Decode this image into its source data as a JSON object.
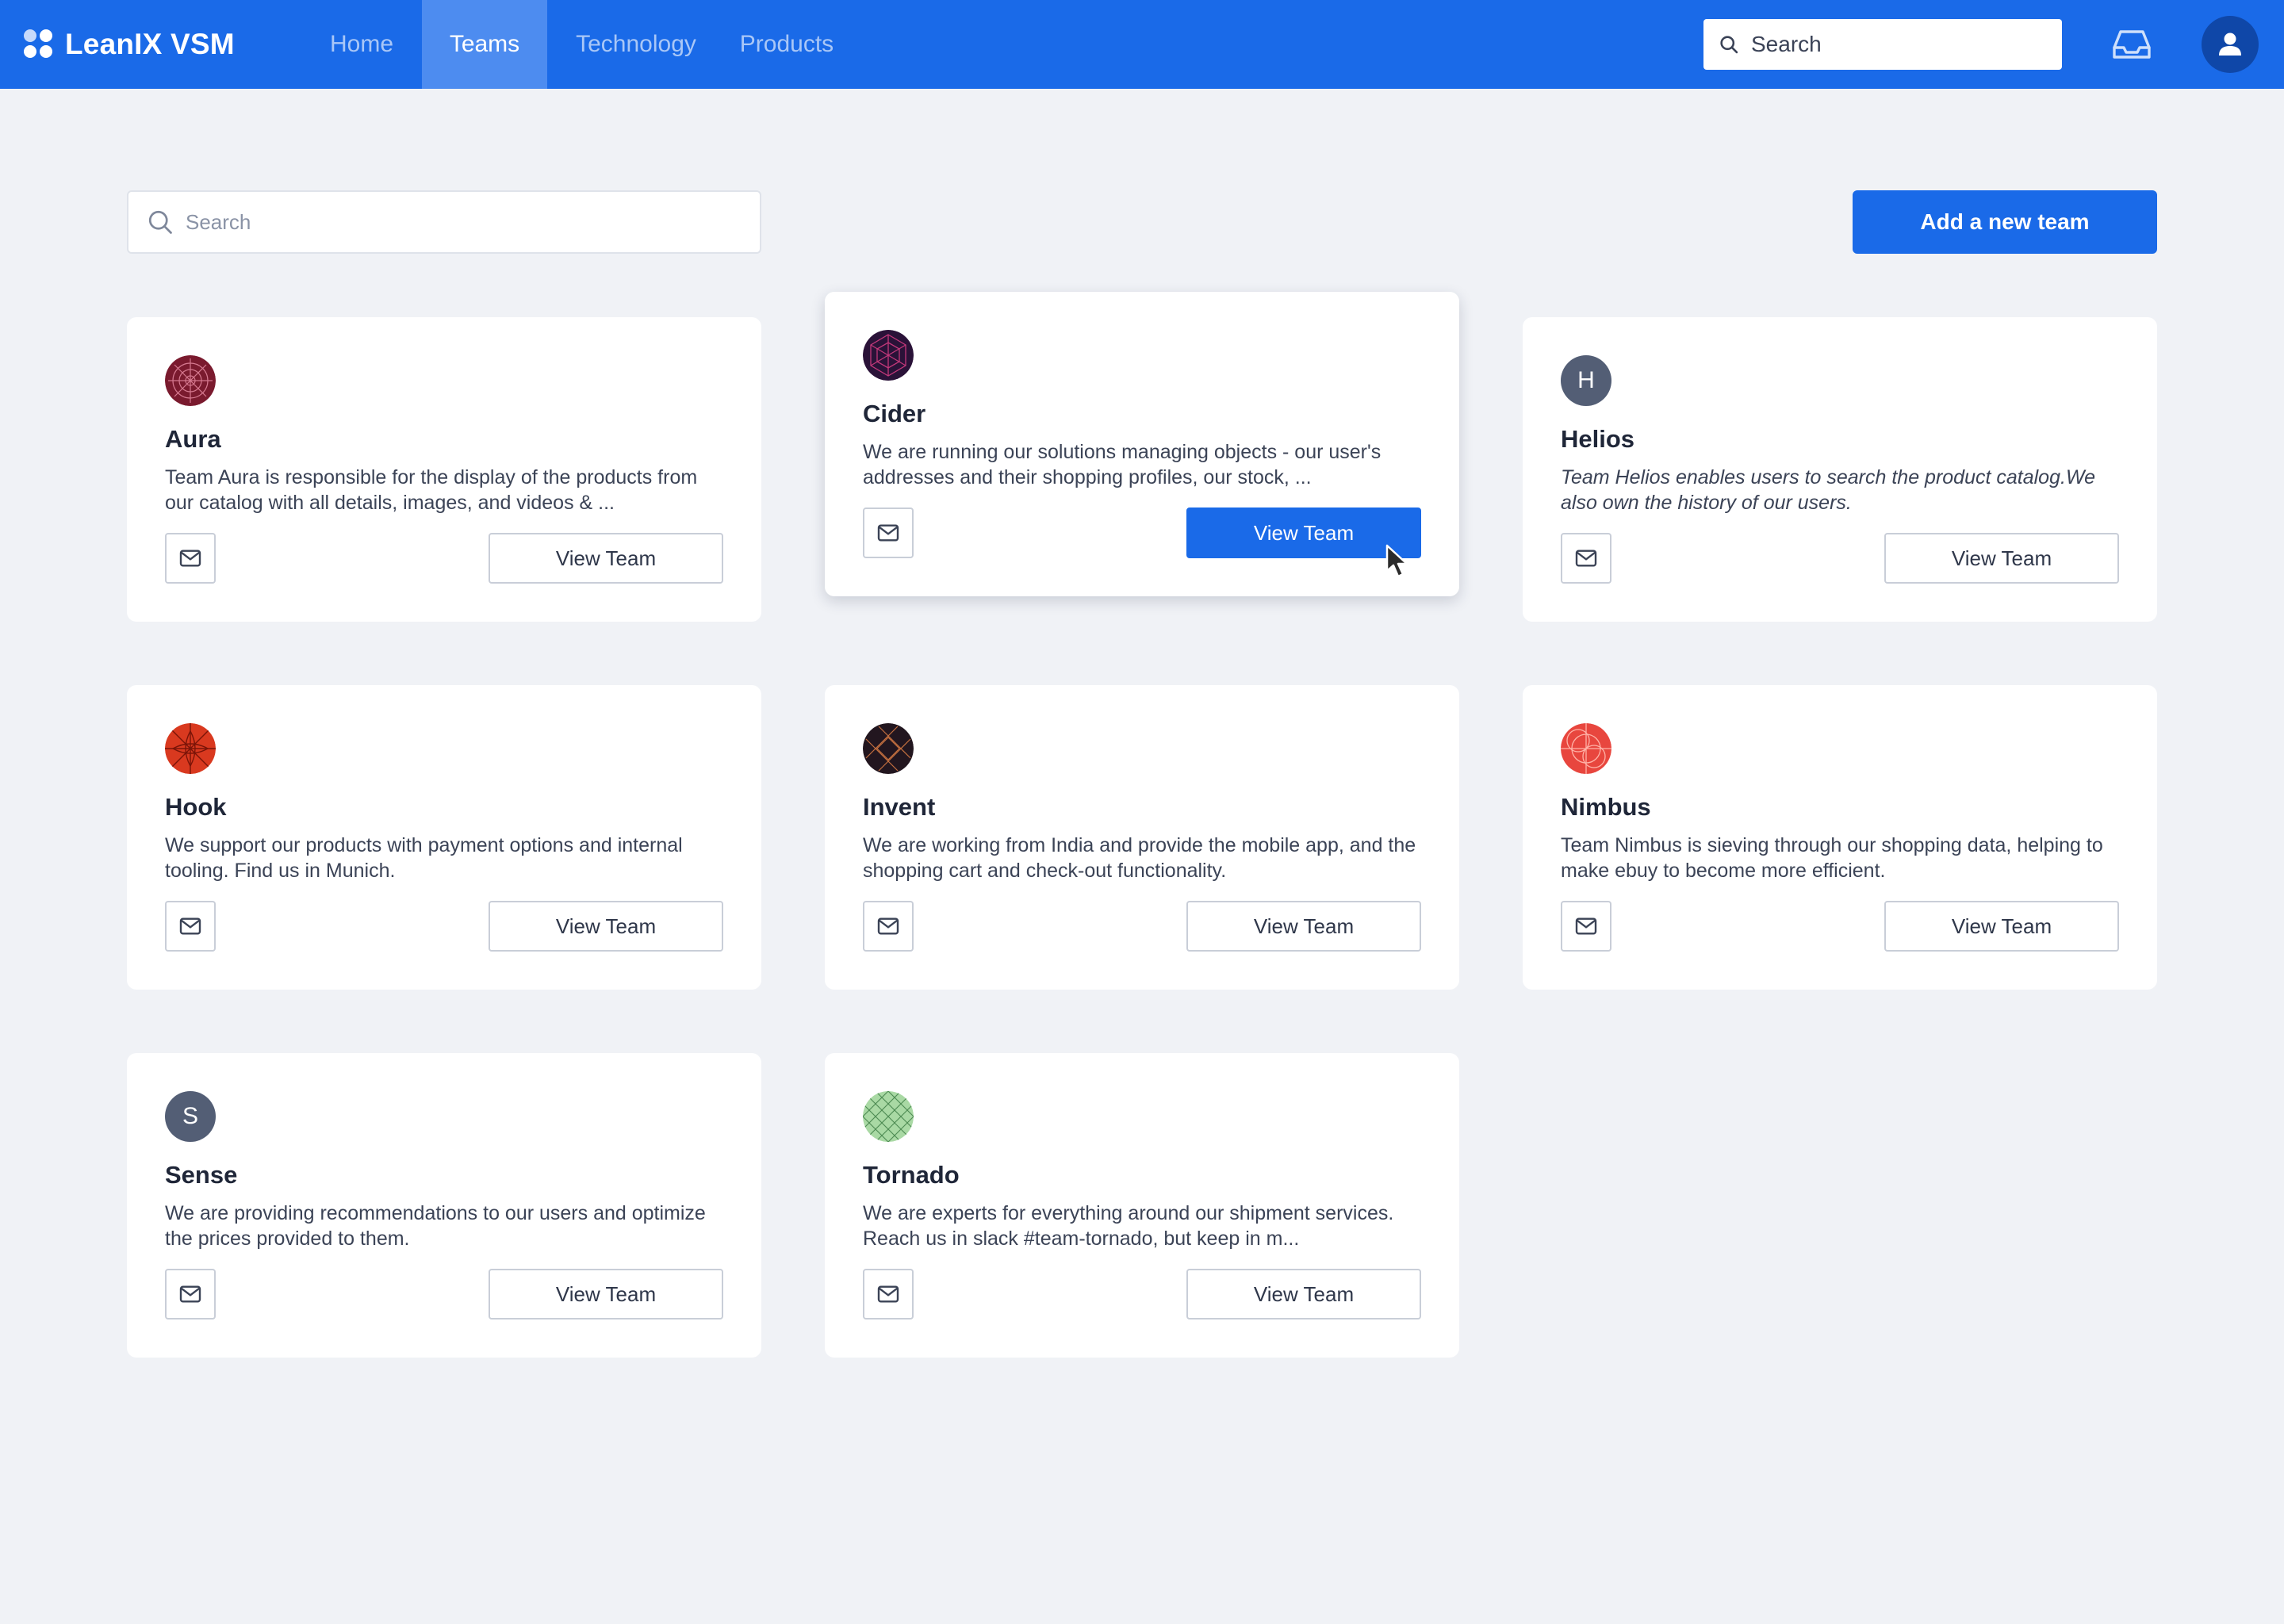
{
  "app": {
    "brand": "LeanIX VSM"
  },
  "nav": {
    "items": [
      {
        "label": "Home",
        "active": false
      },
      {
        "label": "Teams",
        "active": true
      },
      {
        "label": "Technology",
        "active": false
      },
      {
        "label": "Products",
        "active": false
      }
    ],
    "search_placeholder": "Search"
  },
  "toolbar": {
    "search_placeholder": "Search",
    "add_team_label": "Add a new team"
  },
  "colors": {
    "brand_blue": "#1a6ae8",
    "active_tab": "#4d8cf0",
    "background": "#f0f2f6"
  },
  "teams": [
    {
      "name": "Aura",
      "description": "Team Aura is responsible for the display of the products from our catalog with all details, images, and videos & ...",
      "avatar": "aura-pattern-avatar",
      "view_label": "View Team"
    },
    {
      "name": "Cider",
      "description": "We are running our solutions managing objects - our user's addresses and their shopping profiles, our stock, ...",
      "avatar": "cider-pattern-avatar",
      "view_label": "View Team",
      "hovered": true
    },
    {
      "name": "Helios",
      "description": "Team Helios enables users to search the product catalog.We also own the history of our users.",
      "avatar_initial": "H",
      "view_label": "View Team"
    },
    {
      "name": "Hook",
      "description": "We support our products with payment options and internal tooling. Find us in Munich.",
      "avatar": "hook-pattern-avatar",
      "view_label": "View Team"
    },
    {
      "name": "Invent",
      "description": "We are working from India and provide the mobile app, and the shopping cart and check-out functionality.",
      "avatar": "invent-pattern-avatar",
      "view_label": "View Team"
    },
    {
      "name": "Nimbus",
      "description": "Team Nimbus is sieving through our shopping data, helping to make ebuy to become more efficient.",
      "avatar": "nimbus-pattern-avatar",
      "view_label": "View Team"
    },
    {
      "name": "Sense",
      "description": "We are providing recommendations to our users and optimize the prices provided to them.",
      "avatar_initial": "S",
      "view_label": "View Team"
    },
    {
      "name": "Tornado",
      "description": "We are experts for everything around our shipment services. Reach us in slack #team-tornado, but keep in m...",
      "avatar": "tornado-pattern-avatar",
      "view_label": "View Team"
    }
  ]
}
